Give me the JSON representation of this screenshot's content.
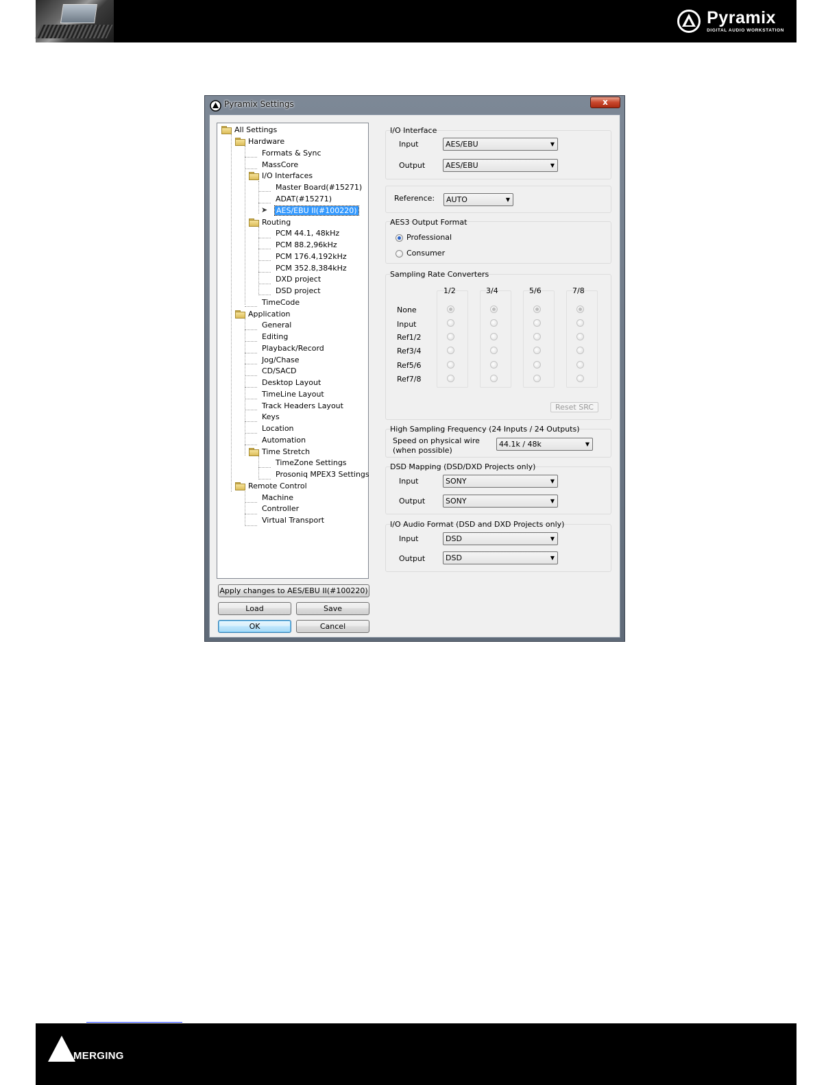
{
  "header": {
    "brand_name": "Pyramix",
    "brand_tagline": "DIGITAL AUDIO WORKSTATION"
  },
  "footer": {
    "logo_text": "MERGING"
  },
  "dialog": {
    "title": "Pyramix Settings",
    "close_glyph": "x",
    "tree": [
      {
        "label": "All Settings"
      },
      {
        "label": "Hardware"
      },
      {
        "label": "Formats & Sync"
      },
      {
        "label": "MassCore"
      },
      {
        "label": "I/O Interfaces"
      },
      {
        "label": "Master Board(#15271)"
      },
      {
        "label": "ADAT(#15271)"
      },
      {
        "label": "AES/EBU II(#100220)"
      },
      {
        "label": "Routing"
      },
      {
        "label": "PCM 44.1, 48kHz"
      },
      {
        "label": "PCM 88.2,96kHz"
      },
      {
        "label": "PCM 176.4,192kHz"
      },
      {
        "label": "PCM 352.8,384kHz"
      },
      {
        "label": "DXD project"
      },
      {
        "label": "DSD project"
      },
      {
        "label": "TimeCode"
      },
      {
        "label": "Application"
      },
      {
        "label": "General"
      },
      {
        "label": "Editing"
      },
      {
        "label": "Playback/Record"
      },
      {
        "label": "Jog/Chase"
      },
      {
        "label": "CD/SACD"
      },
      {
        "label": "Desktop Layout"
      },
      {
        "label": "TimeLine Layout"
      },
      {
        "label": "Track Headers Layout"
      },
      {
        "label": "Keys"
      },
      {
        "label": "Location"
      },
      {
        "label": "Automation"
      },
      {
        "label": "Time Stretch"
      },
      {
        "label": "TimeZone Settings"
      },
      {
        "label": "Prosoniq MPEX3 Settings"
      },
      {
        "label": "Remote Control"
      },
      {
        "label": "Machine"
      },
      {
        "label": "Controller"
      },
      {
        "label": "Virtual Transport"
      }
    ],
    "buttons": {
      "apply": "Apply changes to AES/EBU II(#100220)",
      "load": "Load",
      "save": "Save",
      "ok": "OK",
      "cancel": "Cancel"
    },
    "io_interface": {
      "title": "I/O Interface",
      "input_label": "Input",
      "input_value": "AES/EBU",
      "output_label": "Output",
      "output_value": "AES/EBU"
    },
    "reference": {
      "label": "Reference:",
      "value": "AUTO"
    },
    "aes3": {
      "title": "AES3 Output Format",
      "options": [
        "Professional",
        "Consumer"
      ],
      "selected": "Professional"
    },
    "src": {
      "title": "Sampling Rate Converters",
      "columns": [
        "1/2",
        "3/4",
        "5/6",
        "7/8"
      ],
      "rows": [
        "None",
        "Input",
        "Ref1/2",
        "Ref3/4",
        "Ref5/6",
        "Ref7/8"
      ],
      "selected_row": "None",
      "reset_label": "Reset SRC"
    },
    "hsf": {
      "title": "High Sampling Frequency (24 Inputs / 24 Outputs)",
      "label_line1": "Speed on physical wire",
      "label_line2": "(when possible)",
      "value": "44.1k / 48k"
    },
    "dsd_mapping": {
      "title": "DSD Mapping (DSD/DXD Projects only)",
      "input_label": "Input",
      "input_value": "SONY",
      "output_label": "Output",
      "output_value": "SONY"
    },
    "io_audio_format": {
      "title": "I/O Audio Format (DSD and DXD Projects only)",
      "input_label": "Input",
      "input_value": "DSD",
      "output_label": "Output",
      "output_value": "DSD"
    }
  }
}
